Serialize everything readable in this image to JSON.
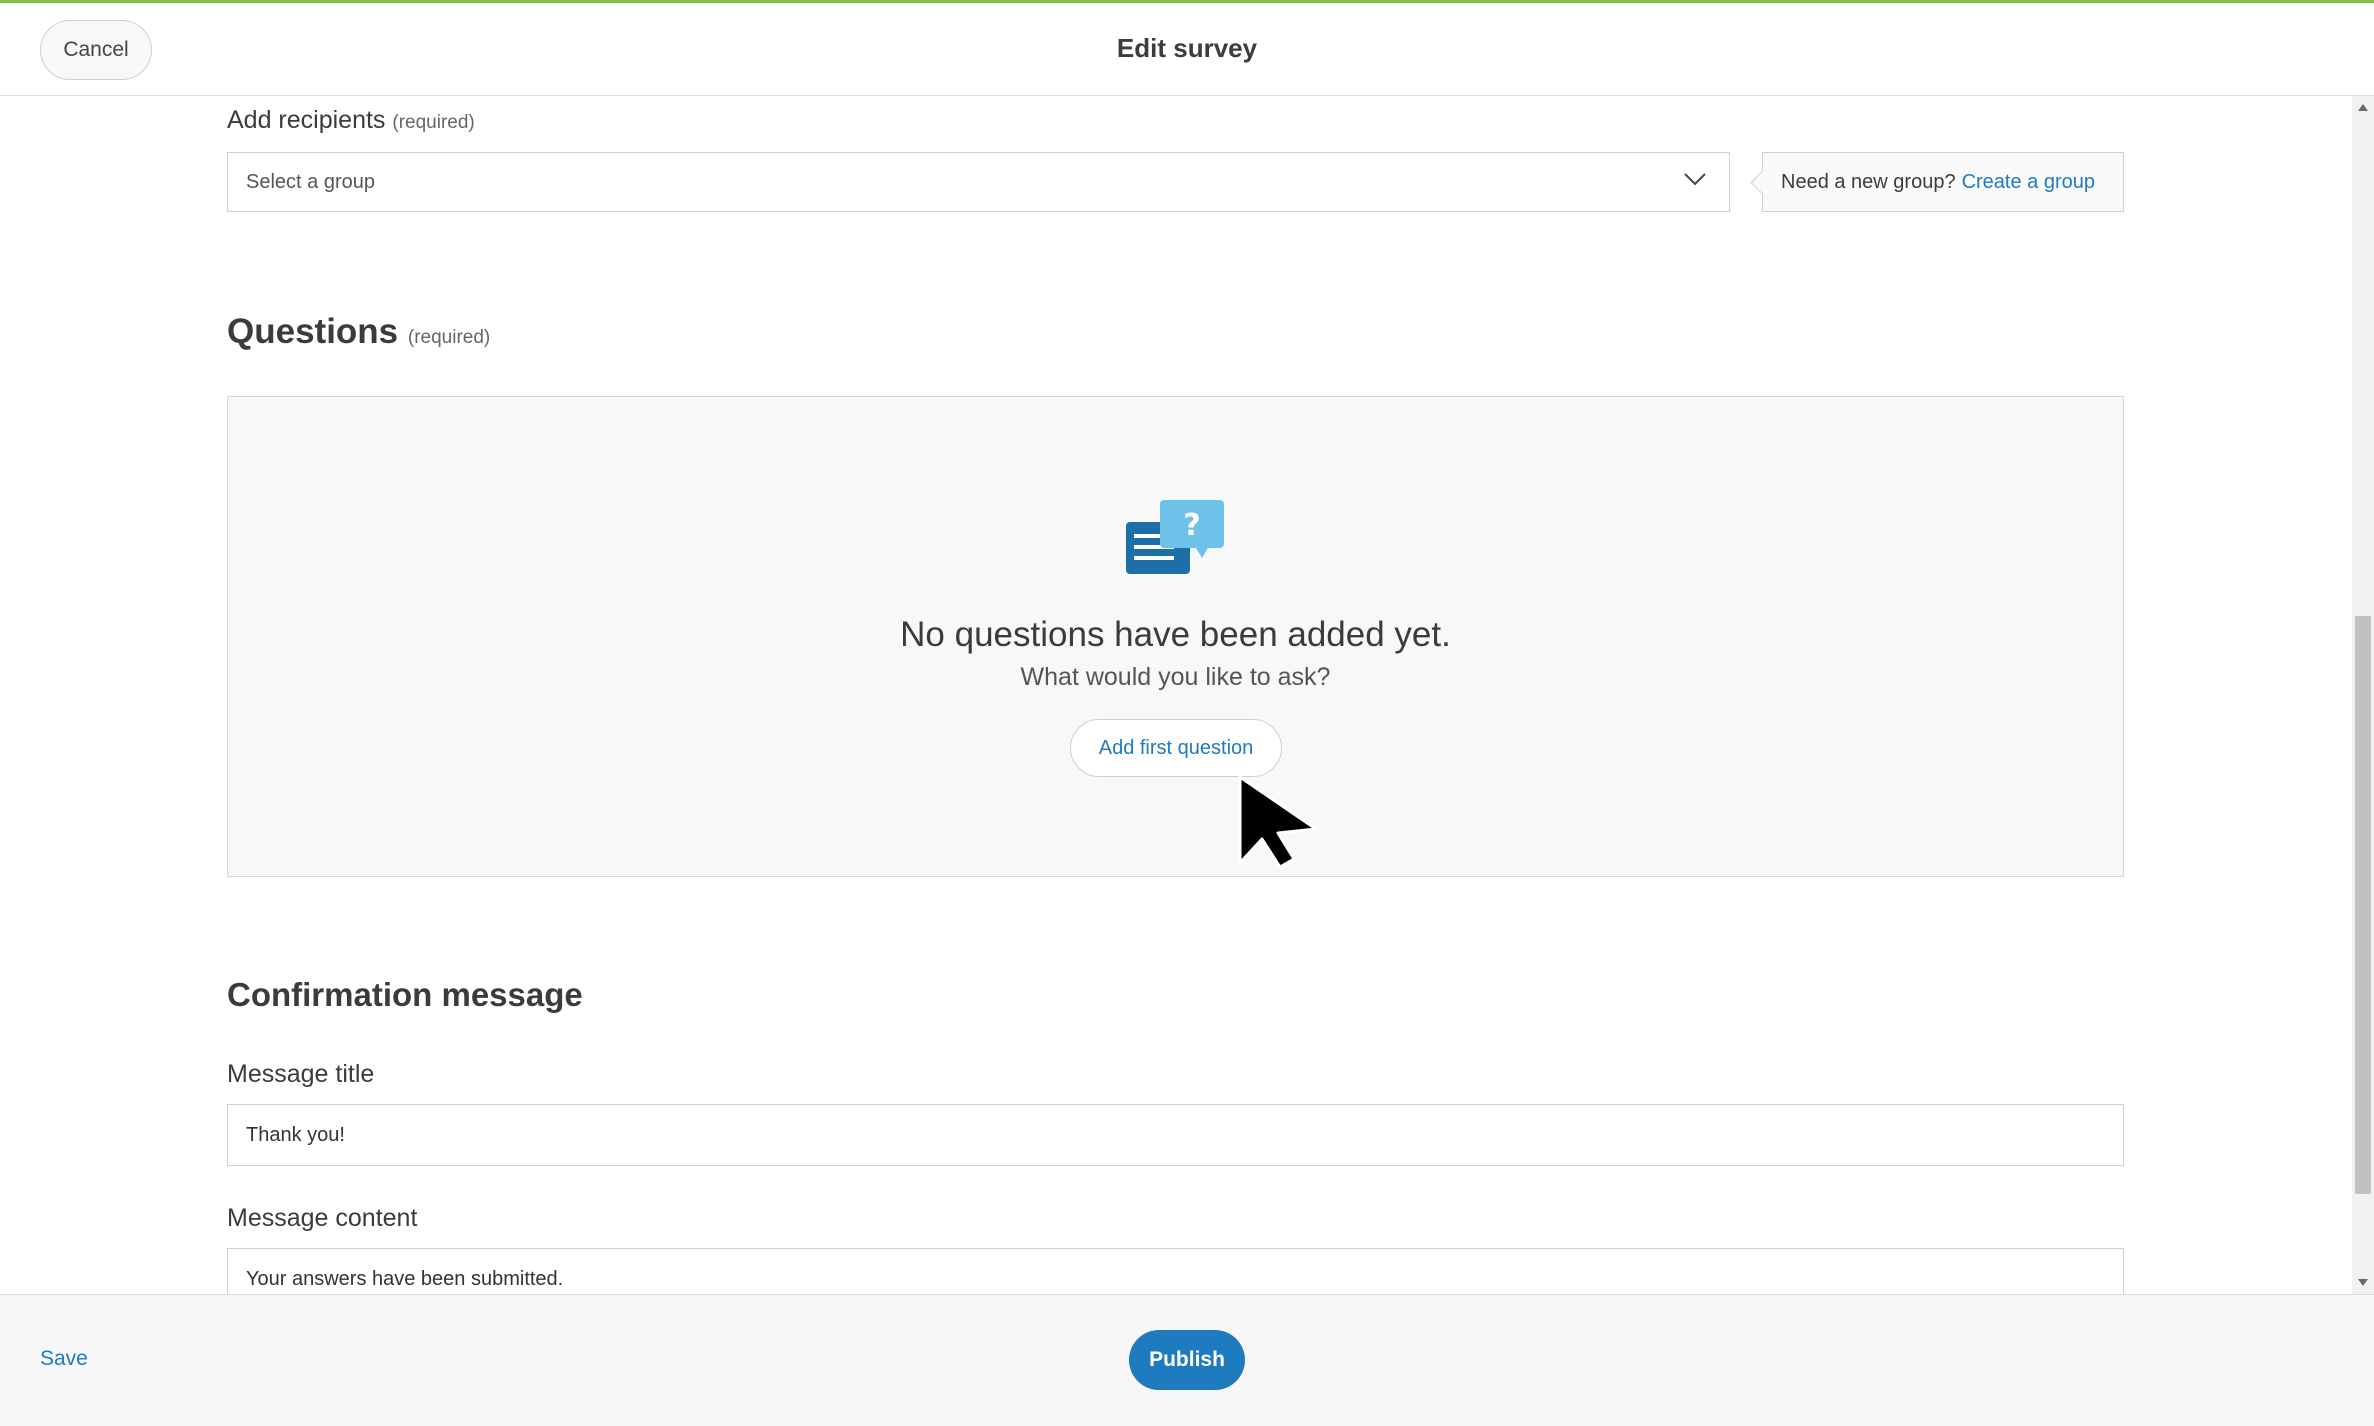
{
  "header": {
    "cancel_label": "Cancel",
    "title": "Edit survey",
    "accent_color": "#7dc242"
  },
  "recipients": {
    "label": "Add recipients",
    "required_note": "(required)",
    "select_placeholder": "Select a group",
    "tip_text": "Need a new group?",
    "tip_link": "Create a group"
  },
  "questions": {
    "heading": "Questions",
    "required_note": "(required)",
    "empty_icon": "survey-question-icon",
    "empty_title": "No questions have been added yet.",
    "empty_subtitle": "What would you like to ask?",
    "add_button_label": "Add first question"
  },
  "confirmation": {
    "heading": "Confirmation message",
    "title_label": "Message title",
    "title_value": "Thank you!",
    "content_label": "Message content",
    "content_value": "Your answers have been submitted."
  },
  "footer": {
    "save_label": "Save",
    "publish_label": "Publish",
    "primary_color": "#1f7bbf"
  }
}
